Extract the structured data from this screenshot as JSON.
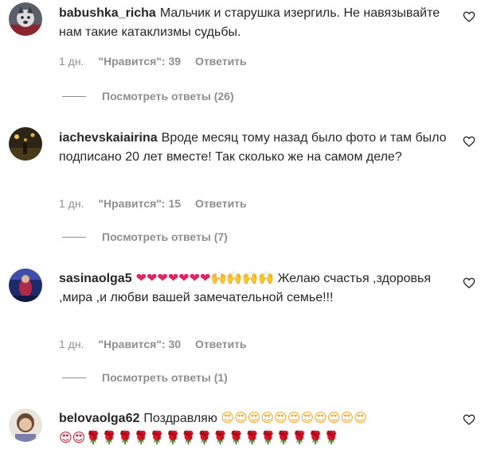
{
  "comments": [
    {
      "username": "babushka_richa",
      "text": "Мальчик и старушка изергиль. Не навязывайте нам такие катаклизмы судьбы.",
      "time": "1 дн.",
      "likes": "\"Нравится\": 39",
      "reply": "Ответить",
      "view_replies": "Посмотреть ответы (26)",
      "avatar_icon": "husky-photo-avatar"
    },
    {
      "username": "iachevskaiairina",
      "text": "Вроде месяц тому назад было фото и там было подписано 20 лет вместе! Так сколько же на самом деле?",
      "time": "1 дн.",
      "likes": "\"Нравится\": 15",
      "reply": "Ответить",
      "view_replies": "Посмотреть ответы (7)",
      "avatar_icon": "night-street-photo-avatar"
    },
    {
      "username": "sasinaolga5",
      "emoji_prefix": "❤❤❤❤❤❤❤🙌🙌🙌🙌",
      "text": "Желаю счастья ,здоровья ,мира ,и любви вашей замечательной семье!!!",
      "time": "1 дн.",
      "likes": "\"Нравится\": 30",
      "reply": "Ответить",
      "view_replies": "Посмотреть ответы (1)",
      "avatar_icon": "stage-photo-avatar"
    },
    {
      "username": "belovaolga62",
      "text": "Поздравляю",
      "emoji_line1": "😍😍😍😍😍😍😍😍😍😍😍",
      "emoji_line2": "😍😍🌹🌹🌹🌹🌹🌹🌹🌹🌹🌹🌹🌹🌹🌹🌹🌹",
      "avatar_icon": "woman-portrait-avatar"
    }
  ],
  "colors": {
    "text": "#262626",
    "muted": "#8e8e8e",
    "heart": "#e0245e"
  }
}
